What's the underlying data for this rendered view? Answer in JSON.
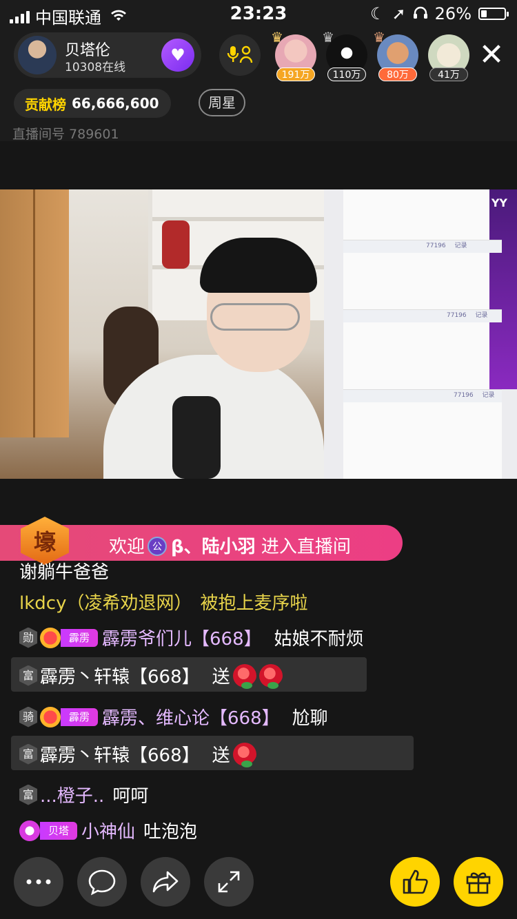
{
  "status_bar": {
    "carrier": "中国联通",
    "time": "23:23",
    "battery": "26%",
    "battery_level": 0.26
  },
  "host": {
    "name": "贝塔伦",
    "online": "10308在线"
  },
  "viewers": [
    {
      "badge": "191万",
      "badge_color": "#f5a623"
    },
    {
      "badge": "110万",
      "badge_color": "#2b2b2b"
    },
    {
      "badge": "80万",
      "badge_color": "#ff6a3a"
    },
    {
      "badge": "41万",
      "badge_color": "#333333"
    }
  ],
  "contribution": {
    "label": "贡献榜",
    "value": "66,666,600"
  },
  "week_star": "周星",
  "room_number": "直播间号 789601",
  "video": {
    "watermark": "YY",
    "screen_labels": [
      "77196",
      "记录",
      "77196",
      "记录",
      "77196",
      "记录"
    ]
  },
  "welcome": {
    "hao_badge": "壕",
    "prefix": "欢迎",
    "beta_icon": "公",
    "user": "β、陆小羽",
    "suffix": "进入直播间"
  },
  "chat": [
    {
      "text": "谢躺牛爸爸",
      "color": "#ffffff"
    },
    {
      "name": "lkdcy（凌希劝退网）",
      "msg": "被抱上麦序啦",
      "color": "#e8d44a"
    },
    {
      "rank": "勋",
      "fanbadge": "霹雳",
      "name": "霹雳爷们儿【668】",
      "msg": "姑娘不耐烦"
    },
    {
      "rank": "富",
      "name": "霹雳丶轩辕【668】",
      "msg": "送",
      "roses": 2
    },
    {
      "rank": "骑",
      "fanbadge": "霹雳",
      "name": "霹雳、维心论【668】",
      "msg": "尬聊"
    },
    {
      "rank": "富",
      "name": "霹雳丶轩辕【668】",
      "msg": "送",
      "roses": 1
    },
    {
      "rank": "富",
      "name": "...橙子..",
      "msg": "呵呵"
    },
    {
      "fanbadge": "贝塔",
      "name": "小神仙",
      "msg": "吐泡泡"
    }
  ],
  "bottom_bar": [
    {
      "icon": "more-icon"
    },
    {
      "icon": "chat-icon"
    },
    {
      "icon": "share-icon"
    },
    {
      "icon": "fullscreen-icon"
    },
    {
      "icon": "like-icon"
    },
    {
      "icon": "gift-icon"
    }
  ],
  "colors": {
    "accent_yellow": "#ffd400",
    "welcome_pink": "#e84a7e",
    "fan_purple": "#c93aff"
  }
}
